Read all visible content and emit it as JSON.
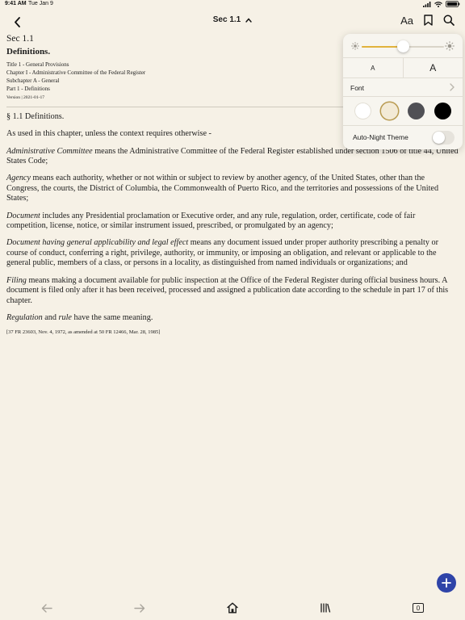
{
  "status": {
    "time": "9:41 AM",
    "date": "Tue Jan 9",
    "battery": "100%"
  },
  "nav": {
    "title": "Sec 1.1",
    "font_button": "Aa"
  },
  "document": {
    "section": "Sec 1.1",
    "heading": "Definitions.",
    "hierarchy": [
      "Title 1 - General Provisions",
      "Chapter I - Administrative Committee of the Federal Register",
      "Subchapter A - General",
      "Part 1 - Definitions"
    ],
    "version": "Version | 2021-01-17",
    "section_title": "§ 1.1 Definitions.",
    "intro": "As used in this chapter, unless the context requires otherwise -",
    "definitions": [
      {
        "term": "Administrative Committee",
        "text": " means the Administrative Committee of the Federal Register established under section 1506 of title 44, United States Code;"
      },
      {
        "term": "Agency",
        "text": " means each authority, whether or not within or subject to review by another agency, of the United States, other than the Congress, the courts, the District of Columbia, the Commonwealth of Puerto Rico, and the territories and possessions of the United States;"
      },
      {
        "term": "Document",
        "text": " includes any Presidential proclamation or Executive order, and any rule, regulation, order, certificate, code of fair competition, license, notice, or similar instrument issued, prescribed, or promulgated by an agency;"
      },
      {
        "term": "Document having general applicability and legal effect",
        "text": " means any document issued under proper authority prescribing a penalty or course of conduct, conferring a right, privilege, authority, or immunity, or imposing an obligation, and relevant or applicable to the general public, members of a class, or persons in a locality, as distinguished from named individuals or organizations; and"
      },
      {
        "term": "Filing",
        "text": " means making a document available for public inspection at the Office of the Federal Register during official business hours. A document is filed only after it has been received, processed and assigned a publication date according to the schedule in part 17 of this chapter."
      }
    ],
    "final": {
      "term1": "Regulation",
      "and": " and ",
      "term2": "rule",
      "text": " have the same meaning."
    },
    "citation": "[37 FR 23603, Nov. 4, 1972, as amended at 50 FR 12466, Mar. 28, 1985]"
  },
  "display_settings": {
    "brightness": 0.5,
    "size_small": "A",
    "size_large": "A",
    "font_label": "Font",
    "auto_night_label": "Auto-Night Theme",
    "auto_night_on": false,
    "themes": [
      {
        "name": "white",
        "color": "#ffffff",
        "selected": false
      },
      {
        "name": "sepia",
        "color": "#f3ead6",
        "selected": true
      },
      {
        "name": "gray",
        "color": "#505055",
        "selected": false
      },
      {
        "name": "black",
        "color": "#000000",
        "selected": false
      }
    ]
  },
  "toolbar": {
    "tab_count": "0"
  },
  "colors": {
    "accent": "#2f44a8",
    "slider_fill": "#e1b33d",
    "background": "#f6f1e6"
  },
  "icons": {
    "back": "chevron-left-icon",
    "title_chevron": "chevron-up-icon",
    "bookmark": "bookmark-icon",
    "search": "search-icon",
    "add": "plus-icon",
    "nav_back": "arrow-left-icon",
    "nav_forward": "arrow-right-icon",
    "home": "home-icon",
    "library": "library-icon",
    "tabs": "tabs-icon"
  }
}
